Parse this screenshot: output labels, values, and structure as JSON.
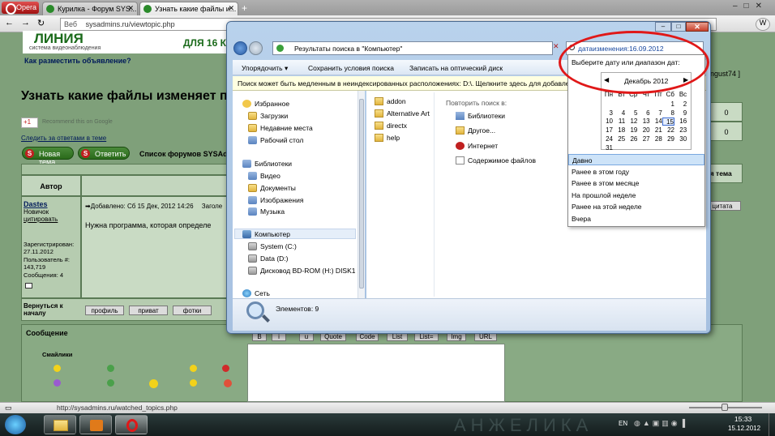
{
  "browser": {
    "opera_label": "Opera",
    "tabs": [
      {
        "label": "Курилка - Форум SYS..."
      },
      {
        "label": "Узнать какие файлы и..."
      }
    ],
    "address": {
      "scheme": "Веб",
      "url": "sysadmins.ru/viewtopic.php"
    },
    "status_url": "http://sysadmins.ru/watched_topics.php"
  },
  "forum": {
    "banner_logo": "ЛИНИЯ",
    "banner_sub": "система видеонаблюдения",
    "banner_right": "ДЛЯ 16 К",
    "ad_link": "Как разместить объявление?",
    "topic_title": "Узнать какие файлы изменяет пр",
    "gplus": "+1",
    "gplus_text": "Recommend this on Google",
    "follow_link": "Следить за ответами в теме",
    "new_topic": "Новая тема",
    "reply": "Ответить",
    "forum_list": "Список форумов SYSAd",
    "author_header": "Автор",
    "topic_header": "ая тема",
    "author_name": "Dastes",
    "author_rank": "Новичок",
    "quote_link": "цитировать",
    "added": "Добавлено: Сб 15 Дек, 2012 14:26",
    "added_tail": "Заголе",
    "post_text": "Нужна программа, которая определе",
    "registered": "Зарегистрирован: 27.11.2012",
    "user_no": "Пользователь #: 143,719",
    "messages": "Сообщения: 4",
    "back_to_top": "Вернуться к началу",
    "profile_btn": "профиль",
    "private_btn": "приват",
    "photos_btn": "фотки",
    "message_label": "Сообщение",
    "smilies_label": "Смайлики",
    "quote_btn": "цитата",
    "right_user": "ngust74 ]",
    "right_zero_1": "0",
    "right_zero_2": "0",
    "editor_buttons": [
      "B",
      "i",
      "u",
      "Quote",
      "Code",
      "List",
      "List=",
      "Img",
      "URL"
    ]
  },
  "explorer": {
    "breadcrumb": "Результаты поиска в \"Компьютер\"",
    "search_text": "датаизменения:16.09.2012",
    "toolbar": [
      "Упорядочить",
      "Сохранить условия поиска",
      "Записать на оптический диск"
    ],
    "infobar": "Поиск может быть медленным в неиндексированных расположениях: D:\\. Щелкните здесь для добавлени",
    "nav": {
      "favorites": "Избранное",
      "fav_items": [
        "Загрузки",
        "Недавние места",
        "Рабочий стол"
      ],
      "libraries": "Библиотеки",
      "lib_items": [
        "Видео",
        "Документы",
        "Изображения",
        "Музыка"
      ],
      "computer": "Компьютер",
      "comp_items": [
        "System (C:)",
        "Data (D:)",
        "Дисковод BD-ROM (H:) DISK1"
      ],
      "network": "Сеть"
    },
    "files": [
      "addon",
      "Alternative Art",
      "directx",
      "help"
    ],
    "repeat_header": "Повторить поиск в:",
    "repeat_items": [
      "Библиотеки",
      "Другое...",
      "Интернет",
      "Содержимое файлов"
    ],
    "status_count": "Элементов: 9"
  },
  "datepicker": {
    "prompt": "Выберите дату или диапазон дат:",
    "month": "Декабрь 2012",
    "weekdays": [
      "Пн",
      "Вт",
      "Ср",
      "Чт",
      "Пт",
      "Сб",
      "Вс"
    ],
    "weeks": [
      [
        "",
        "",
        "",
        "",
        "",
        "1",
        "2"
      ],
      [
        "3",
        "4",
        "5",
        "6",
        "7",
        "8",
        "9"
      ],
      [
        "10",
        "11",
        "12",
        "13",
        "14",
        "15",
        "16"
      ],
      [
        "17",
        "18",
        "19",
        "20",
        "21",
        "22",
        "23"
      ],
      [
        "24",
        "25",
        "26",
        "27",
        "28",
        "29",
        "30"
      ],
      [
        "31",
        "",
        "",
        "",
        "",
        "",
        ""
      ]
    ],
    "today": "15",
    "options": [
      "Давно",
      "Ранее в этом году",
      "Ранее в этом месяце",
      "На прошлой неделе",
      "Ранее на этой неделе",
      "Вчера"
    ],
    "selected_option": "Давно"
  },
  "taskbar": {
    "lang": "EN",
    "time": "15:33",
    "date": "15.12.2012",
    "wallpaper_text": "АНЖЕЛИКА"
  },
  "colors": {
    "accent_red": "#e01818",
    "forum_green": "#7fa07a",
    "selection": "#cde3f8"
  }
}
